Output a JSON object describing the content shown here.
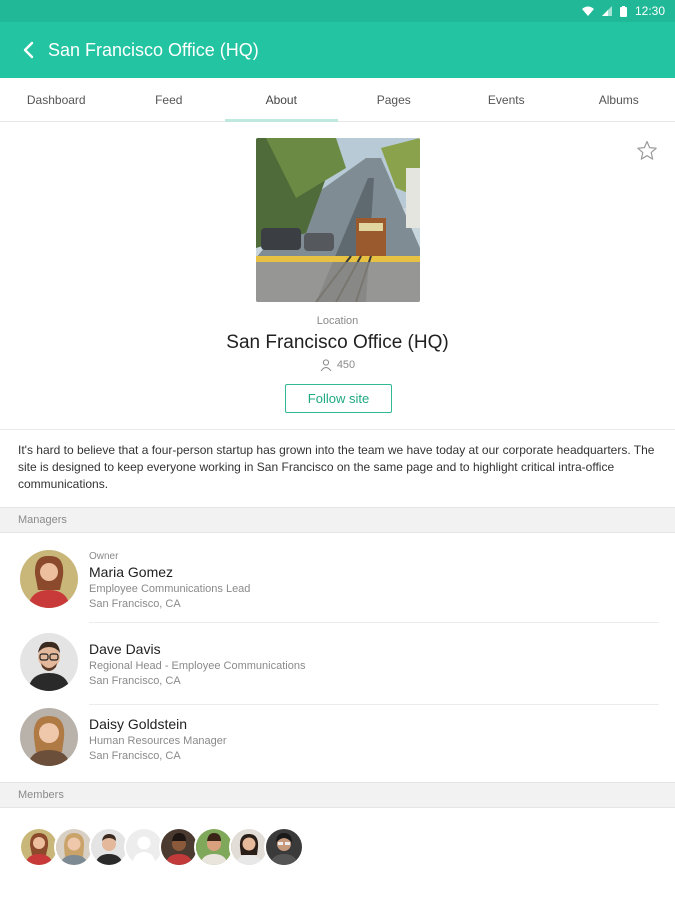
{
  "status_bar": {
    "time": "12:30"
  },
  "app_bar": {
    "title": "San Francisco Office (HQ)"
  },
  "tabs": [
    {
      "label": "Dashboard"
    },
    {
      "label": "Feed"
    },
    {
      "label": "About",
      "active": true
    },
    {
      "label": "Pages"
    },
    {
      "label": "Events"
    },
    {
      "label": "Albums"
    }
  ],
  "site": {
    "type": "Location",
    "name": "San Francisco Office (HQ)",
    "member_count": "450",
    "follow_label": "Follow site",
    "description": "It's hard to believe that a four-person startup has grown into the team we have today at our corporate headquarters. The site is designed to keep everyone working in San Francisco on the same page and to highlight critical intra-office communications."
  },
  "managers": {
    "header": "Managers",
    "items": [
      {
        "role": "Owner",
        "name": "Maria Gomez",
        "title": "Employee Communications Lead",
        "city": "San Francisco, CA"
      },
      {
        "role": "",
        "name": "Dave Davis",
        "title": "Regional Head - Employee Communications",
        "city": "San Francisco, CA"
      },
      {
        "role": "",
        "name": "Daisy Goldstein",
        "title": "Human Resources Manager",
        "city": "San Francisco, CA"
      }
    ]
  },
  "members": {
    "header": "Members",
    "count_shown": 8
  },
  "colors": {
    "accent": "#23c4a1",
    "status_bar": "#20b896",
    "follow_border": "#31b895"
  },
  "icons": {
    "back": "arrow-back-icon",
    "star": "star-outline-icon",
    "person": "person-icon"
  }
}
